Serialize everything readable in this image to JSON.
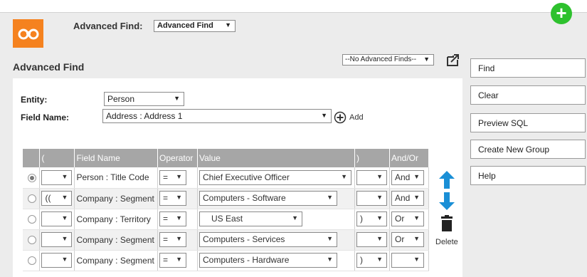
{
  "header": {
    "advanced_find_label": "Advanced Find:",
    "view_select_value": "Advanced Find"
  },
  "page": {
    "title": "Advanced Find",
    "saved_finds_value": "--No Advanced Finds--"
  },
  "form": {
    "entity_label": "Entity:",
    "entity_value": "Person",
    "field_name_label": "Field Name:",
    "field_name_value": "Address : Address 1",
    "add_label": "Add"
  },
  "grid": {
    "columns": [
      "(",
      "Field Name",
      "Operator",
      "Value",
      ")",
      "And/Or"
    ],
    "rows": [
      {
        "selected": true,
        "open": "",
        "field": "Person : Title Code",
        "operator": "=",
        "value": "Chief Executive Officer",
        "close": "",
        "andor": "And"
      },
      {
        "selected": false,
        "open": "((",
        "field": "Company : Segment",
        "operator": "=",
        "value": "Computers - Software",
        "close": "",
        "andor": "And"
      },
      {
        "selected": false,
        "open": "",
        "field": "Company : Territory",
        "operator": "=",
        "value": "US East",
        "close": ")",
        "andor": "Or"
      },
      {
        "selected": false,
        "open": "",
        "field": "Company : Segment",
        "operator": "=",
        "value": "Computers - Services",
        "close": "",
        "andor": "Or"
      },
      {
        "selected": false,
        "open": "",
        "field": "Company : Segment",
        "operator": "=",
        "value": "Computers - Hardware",
        "close": ")",
        "andor": ""
      }
    ]
  },
  "row_actions": {
    "delete_label": "Delete"
  },
  "buttons": {
    "find": "Find",
    "clear": "Clear",
    "preview_sql": "Preview SQL",
    "create_new_group": "Create New Group",
    "help": "Help"
  },
  "colors": {
    "brand_orange": "#f5821f",
    "add_green": "#2ec12e",
    "move_blue": "#1a8fd6",
    "header_gray": "#a6a6a6"
  }
}
